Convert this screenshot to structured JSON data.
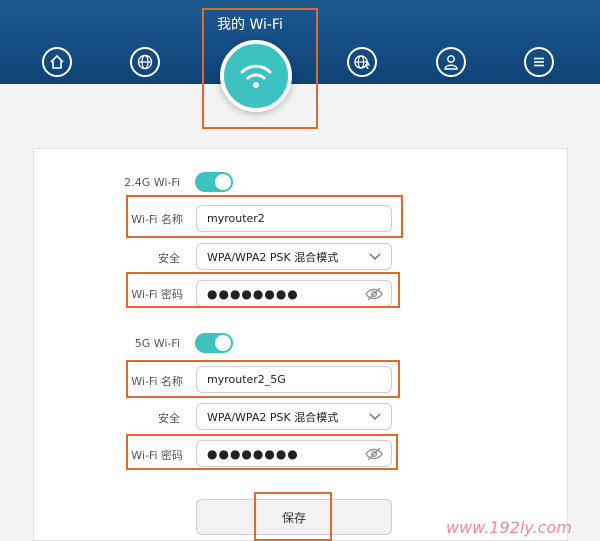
{
  "header": {
    "title": "我的 Wi-Fi",
    "nav_icons": [
      "home-icon",
      "globe-icon",
      "wifi-icon",
      "globe-settings-icon",
      "user-icon",
      "menu-icon"
    ]
  },
  "wifi24": {
    "toggle_label": "2.4G Wi-Fi",
    "enabled": true,
    "name_label": "Wi-Fi 名称",
    "name_value": "myrouter2",
    "security_label": "安全",
    "security_value": "WPA/WPA2 PSK 混合模式",
    "password_label": "Wi-Fi 密码",
    "password_value": "●●●●●●●●"
  },
  "wifi5": {
    "toggle_label": "5G Wi-Fi",
    "enabled": true,
    "name_label": "Wi-Fi 名称",
    "name_value": "myrouter2_5G",
    "security_label": "安全",
    "security_value": "WPA/WPA2 PSK 混合模式",
    "password_label": "Wi-Fi 密码",
    "password_value": "●●●●●●●●"
  },
  "save_label": "保存",
  "watermark": "www.192ly.com",
  "colors": {
    "header": "#1d5a92",
    "accent": "#3cc3c1",
    "highlight": "#e2682c"
  }
}
